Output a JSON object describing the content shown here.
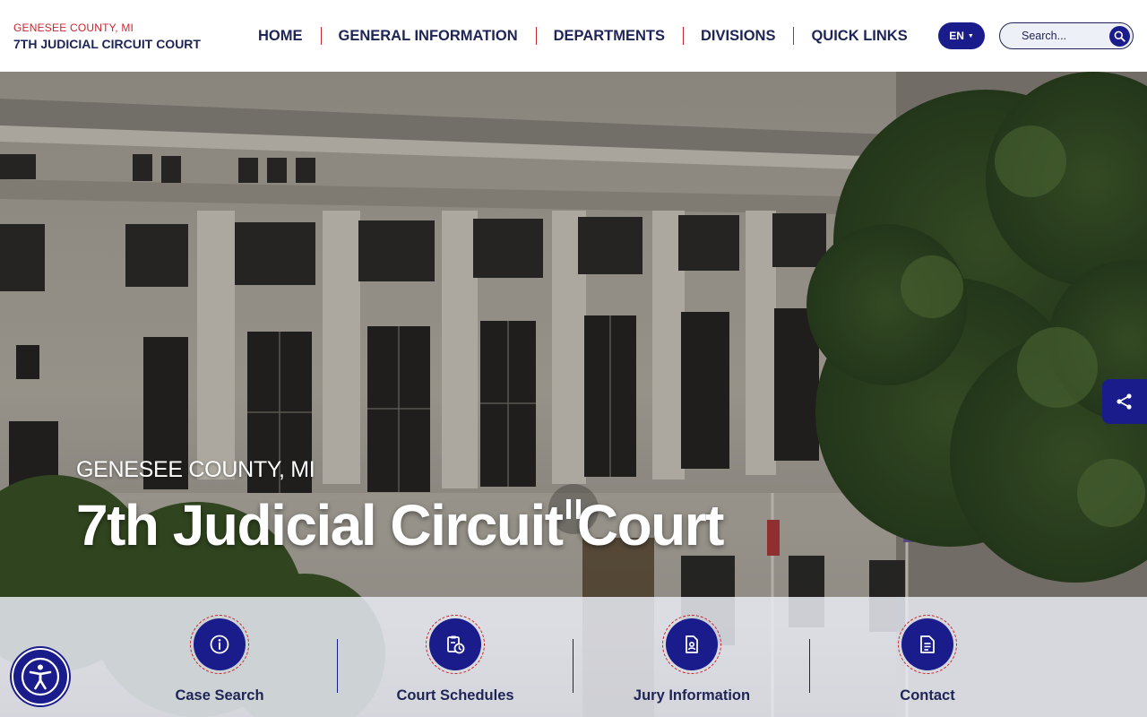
{
  "header": {
    "county": "GENESEE COUNTY, MI",
    "court": "7TH JUDICIAL CIRCUIT COURT",
    "nav": [
      "HOME",
      "GENERAL INFORMATION",
      "DEPARTMENTS",
      "DIVISIONS",
      "QUICK LINKS"
    ],
    "language": "EN",
    "search_placeholder": "Search..."
  },
  "hero": {
    "county": "GENESEE COUNTY, MI",
    "title": "7th Judicial Circuit Court"
  },
  "quick_links": [
    {
      "label": "Case Search",
      "icon": "info-icon"
    },
    {
      "label": "Court Schedules",
      "icon": "clipboard-clock-icon"
    },
    {
      "label": "Jury Information",
      "icon": "id-document-icon"
    },
    {
      "label": "Contact",
      "icon": "document-lines-icon"
    }
  ],
  "colors": {
    "navy": "#1e2455",
    "brand_blue": "#1a1c8c",
    "accent_red": "#c8262f"
  }
}
